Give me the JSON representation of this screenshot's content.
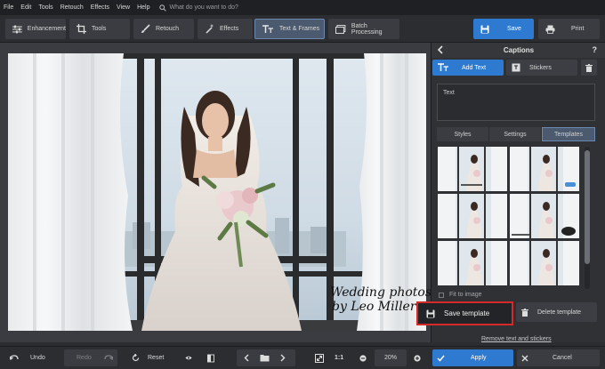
{
  "menu": [
    "File",
    "Edit",
    "Tools",
    "Retouch",
    "Effects",
    "View",
    "Help"
  ],
  "search": {
    "placeholder": "What do you want to do?"
  },
  "toolbar": {
    "tabs": [
      {
        "label": "Enhancement",
        "icon": "sliders-icon"
      },
      {
        "label": "Tools",
        "icon": "crop-icon"
      },
      {
        "label": "Retouch",
        "icon": "brush-icon"
      },
      {
        "label": "Effects",
        "icon": "magic-wand-icon"
      },
      {
        "label": "Text & Frames",
        "icon": "text-icon",
        "active": true
      },
      {
        "label": "Batch Processing",
        "icon": "batch-icon"
      }
    ],
    "save_label": "Save",
    "print_label": "Print"
  },
  "watermark": {
    "line1": "Wedding photos",
    "line2": "by Leo Miller"
  },
  "panel": {
    "title": "Captions",
    "help": "?",
    "add_text_label": "Add Text",
    "stickers_label": "Stickers",
    "text_value": "Text",
    "subtabs": [
      "Styles",
      "Settings",
      "Templates"
    ],
    "active_subtab": "Templates",
    "fit_label": "Fit to image",
    "save_template_label": "Save template",
    "delete_template_label": "Delete template",
    "remove_link": "Remove text and stickers"
  },
  "bottom": {
    "undo": "Undo",
    "redo": "Redo",
    "reset": "Reset",
    "ratio": "1:1",
    "zoom": "20%",
    "apply": "Apply",
    "cancel": "Cancel"
  },
  "colors": {
    "accent": "#2e7ad1",
    "highlight_border": "#d52a2a",
    "active_tab": "#4b5a6f"
  }
}
